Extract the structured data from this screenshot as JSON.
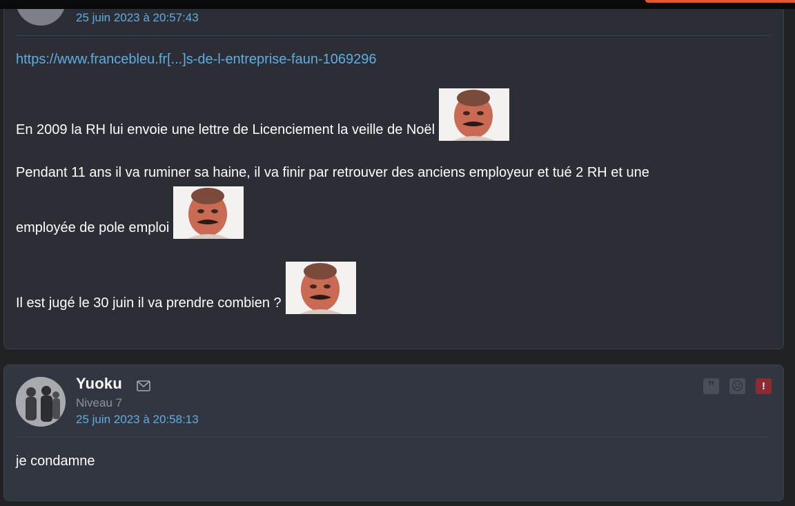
{
  "colors": {
    "background": "#202226",
    "post_bg": "#2b2e35",
    "link": "#5faee3",
    "report": "#8c2a35",
    "accent": "#e8542a"
  },
  "post1": {
    "date": "25 juin 2023 à 20:57:43",
    "link": "https://www.francebleu.fr[...]s-de-l-entreprise-faun-1069296",
    "lines": [
      "En 2009 la RH lui envoie une lettre de Licenciement la veille de Noël",
      "Pendant 11 ans il va ruminer sa haine, il va finir par retrouver des anciens employeur et tué 2 RH et une",
      "employée de pole emploi",
      "Il est jugé le 30 juin il va prendre combien ?"
    ],
    "sticker_icon": "risitas-sticker"
  },
  "post2": {
    "author": "Yuoku",
    "level": "Niveau 7",
    "date": "25 juin 2023 à 20:58:13",
    "body": "je condamne",
    "actions": {
      "quote_icon": "quote-icon",
      "sad_icon": "sad-face-icon",
      "report_icon": "report-icon",
      "quote_glyph": "”",
      "sad_glyph": "☹",
      "report_glyph": "!"
    },
    "mail_icon": "mail-icon"
  }
}
